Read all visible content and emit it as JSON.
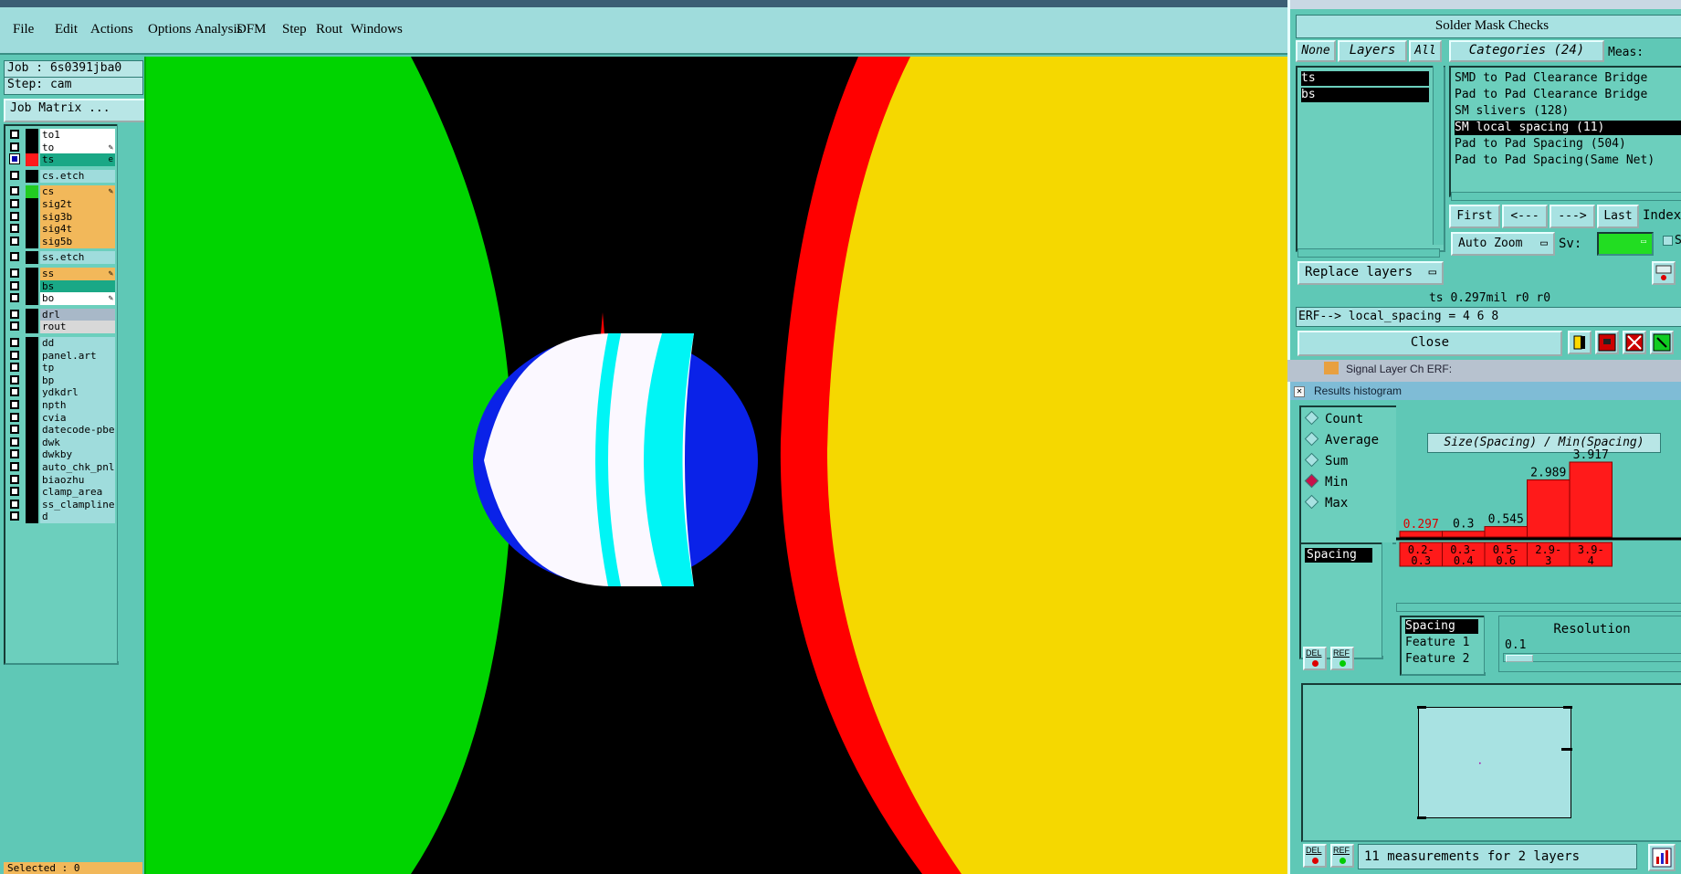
{
  "menu": [
    "File",
    "Edit",
    "Actions",
    "Options",
    "Analysis",
    "DFM",
    "Step",
    "Rout",
    "Windows"
  ],
  "job": {
    "label": "Job : 6s0391jba0",
    "step": "Step: cam",
    "matrix_button": "Job Matrix ...",
    "selected": "Selected : 0"
  },
  "layers": [
    {
      "name": "to1",
      "color": "#ffffff",
      "swatch": "#000000",
      "checked": false
    },
    {
      "name": "to",
      "color": "#ffffff",
      "swatch": "#000000",
      "checked": false,
      "pen": true
    },
    {
      "name": "ts",
      "color": "#1aa886",
      "swatch": "#ff1a1a",
      "checked": true,
      "mark": "e"
    },
    {
      "name": "cs.etch",
      "color": "#9fdcdc",
      "swatch": "#000000",
      "checked": false,
      "gap": true
    },
    {
      "name": "cs",
      "color": "#f2b85a",
      "swatch": "#22cc22",
      "checked": false,
      "pen": true,
      "gap": true
    },
    {
      "name": "sig2t",
      "color": "#f2b85a",
      "swatch": "#000000",
      "checked": false
    },
    {
      "name": "sig3b",
      "color": "#f2b85a",
      "swatch": "#000000",
      "checked": false
    },
    {
      "name": "sig4t",
      "color": "#f2b85a",
      "swatch": "#000000",
      "checked": false
    },
    {
      "name": "sig5b",
      "color": "#f2b85a",
      "swatch": "#000000",
      "checked": false
    },
    {
      "name": "ss.etch",
      "color": "#9fdcdc",
      "swatch": "#000000",
      "checked": false,
      "gap": true
    },
    {
      "name": "ss",
      "color": "#f2b85a",
      "swatch": "#000000",
      "checked": false,
      "pen": true,
      "gap": true
    },
    {
      "name": "bs",
      "color": "#1aa886",
      "swatch": "#000000",
      "checked": false
    },
    {
      "name": "bo",
      "color": "#ffffff",
      "swatch": "#000000",
      "checked": false,
      "pen": true
    },
    {
      "name": "drl",
      "color": "#a8b8c8",
      "swatch": "#000000",
      "checked": false,
      "gap": true
    },
    {
      "name": "rout",
      "color": "#d8d8d8",
      "swatch": "#000000",
      "checked": false
    },
    {
      "name": "dd",
      "color": "#9fdcdc",
      "swatch": "#000000",
      "checked": false,
      "gap": true
    },
    {
      "name": "panel.art",
      "color": "#9fdcdc",
      "swatch": "#000000",
      "checked": false
    },
    {
      "name": "tp",
      "color": "#9fdcdc",
      "swatch": "#000000",
      "checked": false
    },
    {
      "name": "bp",
      "color": "#9fdcdc",
      "swatch": "#000000",
      "checked": false
    },
    {
      "name": "ydkdrl",
      "color": "#9fdcdc",
      "swatch": "#000000",
      "checked": false
    },
    {
      "name": "npth",
      "color": "#9fdcdc",
      "swatch": "#000000",
      "checked": false
    },
    {
      "name": "cvia",
      "color": "#9fdcdc",
      "swatch": "#000000",
      "checked": false
    },
    {
      "name": "datecode-pbe",
      "color": "#9fdcdc",
      "swatch": "#000000",
      "checked": false
    },
    {
      "name": "dwk",
      "color": "#9fdcdc",
      "swatch": "#000000",
      "checked": false
    },
    {
      "name": "dwkby",
      "color": "#9fdcdc",
      "swatch": "#000000",
      "checked": false
    },
    {
      "name": "auto_chk_pnl",
      "color": "#9fdcdc",
      "swatch": "#000000",
      "checked": false
    },
    {
      "name": "biaozhu",
      "color": "#9fdcdc",
      "swatch": "#000000",
      "checked": false
    },
    {
      "name": "clamp_area",
      "color": "#9fdcdc",
      "swatch": "#000000",
      "checked": false
    },
    {
      "name": "ss_clampline",
      "color": "#9fdcdc",
      "swatch": "#000000",
      "checked": false
    },
    {
      "name": "d",
      "color": "#9fdcdc",
      "swatch": "#000000",
      "checked": false
    }
  ],
  "viewer": {
    "title": "Solder Mask Checks",
    "tabs": {
      "none": "None",
      "layers": "Layers",
      "all": "All"
    },
    "categories_label": "Categories (24)",
    "meas_label": "Meas:",
    "layer_items": [
      "ts",
      "bs"
    ],
    "categories": [
      "SMD to Pad Clearance Bridge",
      "Pad to Pad Clearance Bridge",
      "SM slivers (128)",
      "SM local spacing (11)",
      "Pad to Pad Spacing (504)",
      "Pad to Pad Spacing(Same Net)"
    ],
    "selected_category": 3,
    "nav": {
      "first": "First",
      "prev": "<---",
      "next": "--->",
      "last": "Last",
      "index": "Index:"
    },
    "auto_zoom": "Auto Zoom",
    "sv_label": "Sv:",
    "sh_label": "Sh",
    "replace_layers": "Replace layers",
    "status": "ts 0.297mil  r0  r0",
    "erf": "ERF--> local_spacing = 4 6 8",
    "close": "Close",
    "bg_caption": "Signal Layer Ch ERF:"
  },
  "histogram": {
    "title": "Results histogram",
    "modes": [
      "Count",
      "Average",
      "Sum",
      "Min",
      "Max"
    ],
    "selected_mode": "Min",
    "plot_title": "Size(Spacing) / Min(Spacing)",
    "left_list": [
      "Spacing"
    ],
    "axis_list": [
      "Spacing",
      "Feature 1",
      "Feature 2"
    ],
    "resolution_label": "Resolution",
    "resolution_value": "0.1",
    "footer": "11 measurements for 2 layers",
    "del": "DEL",
    "ref": "REF"
  },
  "chart_data": {
    "type": "bar",
    "title": "Size(Spacing) / Min(Spacing)",
    "categories": [
      "0.2-0.3",
      "0.3-0.4",
      "0.5-0.6",
      "2.9-3",
      "3.9-4"
    ],
    "values": [
      0.297,
      0.3,
      0.545,
      2.989,
      3.917
    ],
    "value_labels": [
      "0.297",
      "0.3",
      "0.545",
      "2.989",
      "3.917"
    ],
    "category_labels": [
      [
        "0.2-",
        "0.3"
      ],
      [
        "0.3-",
        "0.4"
      ],
      [
        "0.5-",
        "0.6"
      ],
      [
        "2.9-",
        "3"
      ],
      [
        "3.9-",
        "4"
      ]
    ],
    "ylim": [
      0,
      3.917
    ],
    "bar_color": "#ff1a1a",
    "grid": false
  }
}
